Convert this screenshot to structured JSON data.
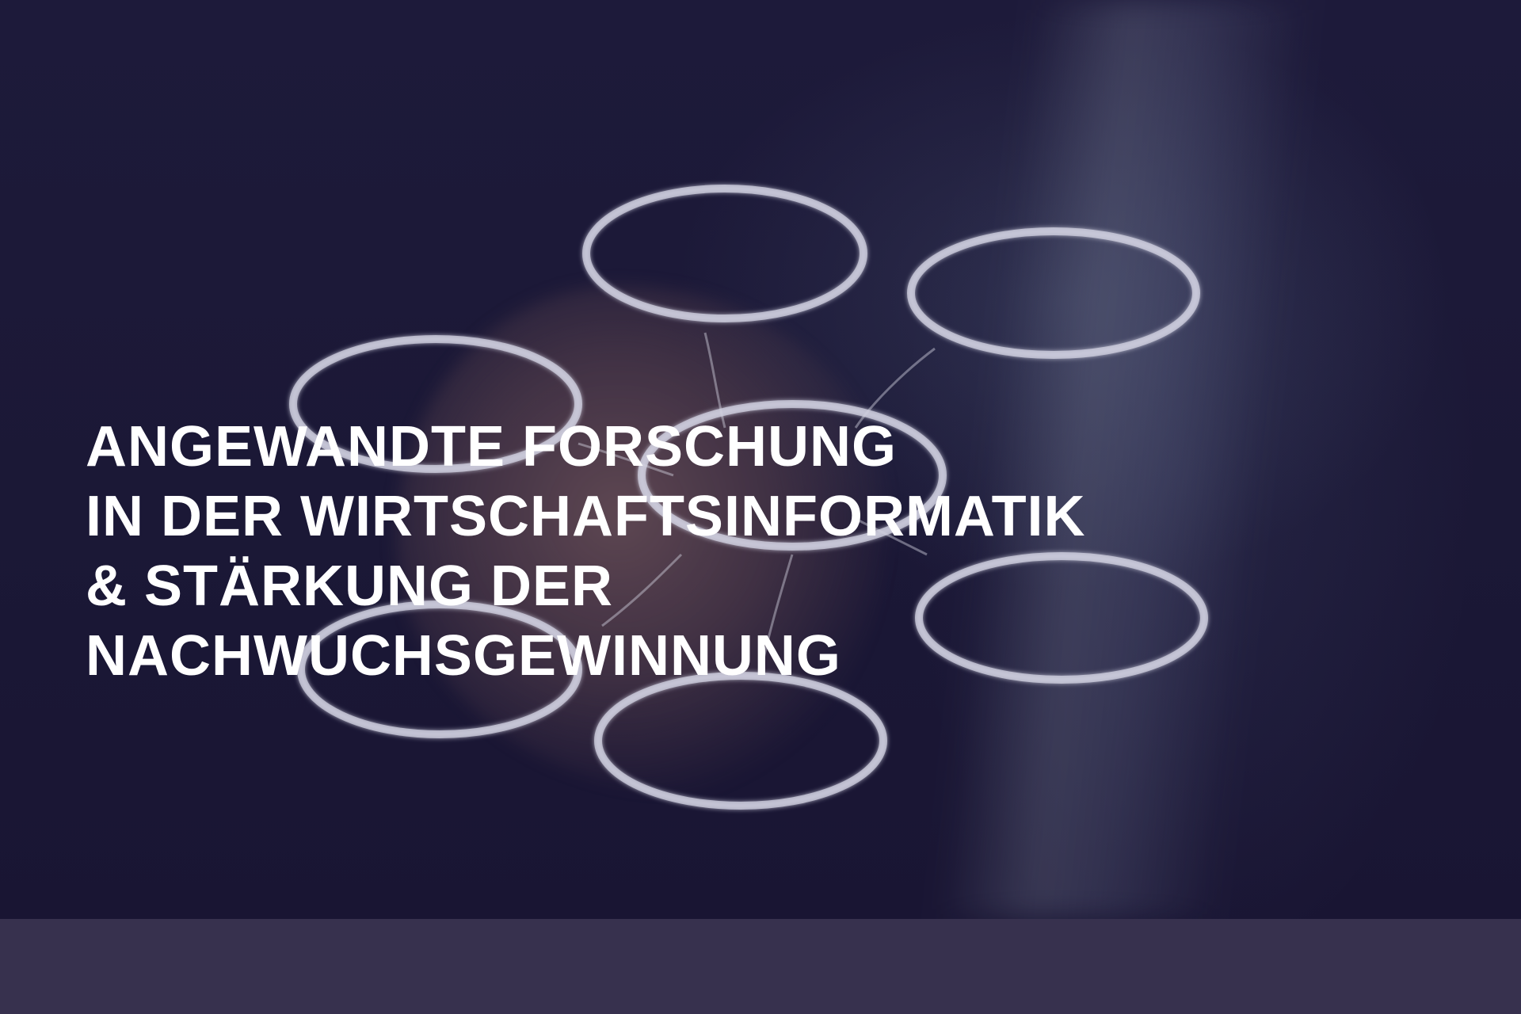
{
  "hero": {
    "title_lines": [
      "ANGEWANDTE FORSCHUNG",
      "IN DER WIRTSCHAFTSINFORMATIK",
      "& STÄRKUNG DER",
      "NACHWUCHSGEWINNUNG"
    ]
  },
  "colors": {
    "background": "#1b1836",
    "footer_band": "#37314e",
    "title_text": "#ffffff"
  }
}
